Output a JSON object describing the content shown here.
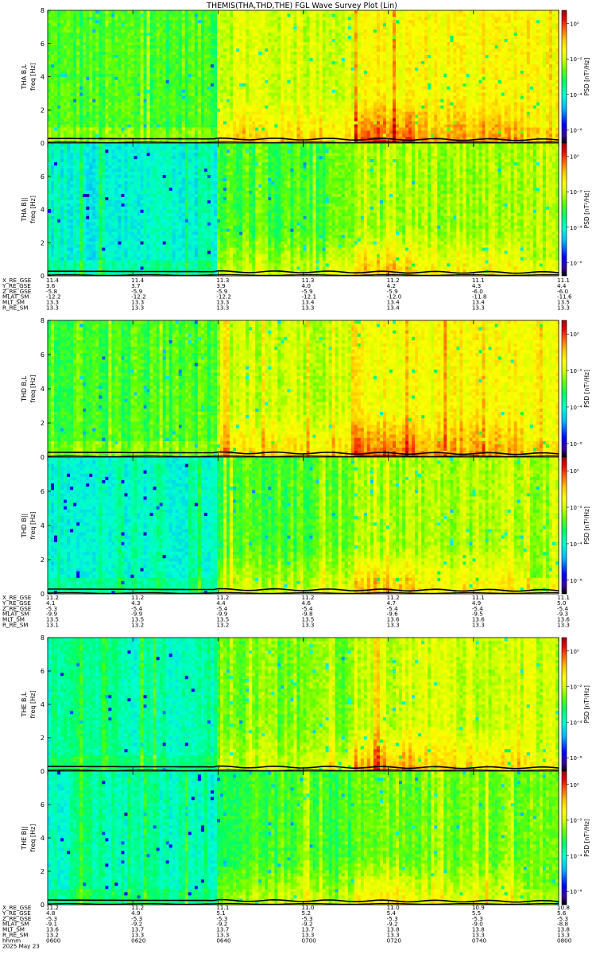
{
  "title": "THEMIS(THA,THD,THE) FGL Wave Survey Plot (Lin)",
  "colors": {
    "colormap": [
      "#000000",
      "#3a00a0",
      "#0000ff",
      "#00b4ff",
      "#00ffd2",
      "#00ff64",
      "#64ff00",
      "#d2ff00",
      "#ffff00",
      "#ffc800",
      "#ff6400",
      "#e60000",
      "#a00000"
    ],
    "trace": "#000000"
  },
  "chart_data": [
    {
      "type": "heatmap",
      "label": "THA B,L",
      "yunit": "freq [Hz]",
      "ytick_labels": [
        "0",
        "2",
        "4",
        "6",
        "8"
      ],
      "ylim": [
        0,
        8
      ],
      "cbar_label": "PSD [nT²/Hz]",
      "cbar_ticks": [
        "10⁰",
        "10⁻²",
        "10⁻⁴",
        "10⁻⁶"
      ],
      "cbar_ticks_data": [
        0,
        -2,
        -4,
        -6
      ]
    },
    {
      "type": "heatmap",
      "label": "THA B||",
      "yunit": "freq [Hz]",
      "ytick_labels": [
        "0",
        "2",
        "4",
        "6"
      ],
      "ylim": [
        0,
        8
      ],
      "cbar_label": "PSD [nT²/Hz]",
      "cbar_ticks": [
        "10⁰",
        "10⁻²",
        "10⁻⁴",
        "10⁻⁶"
      ],
      "cbar_ticks_data": [
        0,
        -2,
        -4,
        -6
      ]
    },
    {
      "type": "heatmap",
      "label": "THD B,L",
      "yunit": "freq [Hz]",
      "ytick_labels": [
        "0",
        "2",
        "4",
        "6",
        "8"
      ],
      "ylim": [
        0,
        8
      ],
      "cbar_label": "PSD [nT²/Hz]",
      "cbar_ticks": [
        "10⁰",
        "10⁻²",
        "10⁻⁴",
        "10⁻⁶"
      ],
      "cbar_ticks_data": [
        0,
        -2,
        -4,
        -6
      ]
    },
    {
      "type": "heatmap",
      "label": "THD B||",
      "yunit": "freq [Hz]",
      "ytick_labels": [
        "0",
        "2",
        "4",
        "6"
      ],
      "ylim": [
        0,
        8
      ],
      "cbar_label": "PSD [nT²/Hz]",
      "cbar_ticks": [
        "10⁰",
        "10⁻²",
        "10⁻⁴",
        "10⁻⁶"
      ],
      "cbar_ticks_data": [
        0,
        -2,
        -4,
        -6
      ]
    },
    {
      "type": "heatmap",
      "label": "THE B,L",
      "yunit": "freq [Hz]",
      "ytick_labels": [
        "0",
        "2",
        "4",
        "6",
        "8"
      ],
      "ylim": [
        0,
        8
      ],
      "cbar_label": "PSD [nT²/Hz]",
      "cbar_ticks": [
        "10⁰",
        "10⁻²",
        "10⁻⁴",
        "10⁻⁶"
      ],
      "cbar_ticks_data": [
        0,
        -2,
        -4,
        -6
      ]
    },
    {
      "type": "heatmap",
      "label": "THE B||",
      "yunit": "freq [Hz]",
      "ytick_labels": [
        "0",
        "2",
        "4",
        "6"
      ],
      "ylim": [
        0,
        8
      ],
      "cbar_label": "PSD [nT²/Hz]",
      "cbar_ticks": [
        "10⁰",
        "10⁻²",
        "10⁻⁴",
        "10⁻⁶"
      ],
      "cbar_ticks_data": [
        0,
        -2,
        -4,
        -6
      ]
    }
  ],
  "orbit_tables": [
    {
      "row_labels": [
        "X_RE_GSE",
        "Y_RE_GSE",
        "Z_RE_GSE",
        "MLAT_SM",
        "MLT_SM",
        "R_RE_SM"
      ],
      "columns": [
        [
          "11.4",
          "3.6",
          "-5.8",
          "-12.2",
          "13.3",
          "13.3"
        ],
        [
          "11.4",
          "3.7",
          "-5.9",
          "-12.2",
          "13.3",
          "13.3"
        ],
        [
          "11.3",
          "3.9",
          "-5.9",
          "-12.2",
          "13.3",
          "13.3"
        ],
        [
          "11.3",
          "4.0",
          "-5.9",
          "-12.1",
          "13.4",
          "13.3"
        ],
        [
          "11.2",
          "4.2",
          "-5.9",
          "-12.0",
          "13.4",
          "13.4"
        ],
        [
          "11.1",
          "4.3",
          "-6.0",
          "-11.8",
          "13.4",
          "13.3"
        ],
        [
          "11.1",
          "4.4",
          "-6.0",
          "-11.6",
          "13.5",
          "13.3"
        ]
      ]
    },
    {
      "row_labels": [
        "X_RE_GSE",
        "Y_RE_GSE",
        "Z_RE_GSE",
        "MLAT_SM",
        "MLT_SM",
        "R_RE_SM"
      ],
      "columns": [
        [
          "11.2",
          "4.1",
          "-5.3",
          "-9.9",
          "13.5",
          "13.1"
        ],
        [
          "11.2",
          "4.3",
          "-5.4",
          "-9.9",
          "13.5",
          "13.2"
        ],
        [
          "11.2",
          "4.4",
          "-5.4",
          "-9.9",
          "13.5",
          "13.2"
        ],
        [
          "11.2",
          "4.6",
          "-5.4",
          "-9.8",
          "13.5",
          "13.3"
        ],
        [
          "11.2",
          "4.7",
          "-5.4",
          "-9.6",
          "13.6",
          "13.3"
        ],
        [
          "11.1",
          "4.9",
          "-5.4",
          "-9.5",
          "13.6",
          "13.3"
        ],
        [
          "11.1",
          "5.0",
          "-5.4",
          "-9.3",
          "13.6",
          "13.3"
        ]
      ]
    },
    {
      "row_labels": [
        "X_RE_GSE",
        "Y_RE_GSE",
        "Z_RE_GSE",
        "MLAT_SM",
        "MLT_SM",
        "R_RE_SM",
        "hhmm"
      ],
      "columns": [
        [
          "11.2",
          "4.8",
          "-5.3",
          "-9.1",
          "13.6",
          "13.2",
          "0600"
        ],
        [
          "11.2",
          "4.9",
          "-5.3",
          "-9.2",
          "13.7",
          "13.3",
          "0620"
        ],
        [
          "11.1",
          "5.1",
          "-5.3",
          "-9.2",
          "13.7",
          "13.3",
          "0640"
        ],
        [
          "11.0",
          "5.2",
          "-5.3",
          "-9.2",
          "13.7",
          "13.3",
          "0700"
        ],
        [
          "11.0",
          "5.4",
          "-5.3",
          "-9.2",
          "13.8",
          "13.3",
          "0720"
        ],
        [
          "10.9",
          "5.5",
          "-5.3",
          "-9.0",
          "13.8",
          "13.3",
          "0740"
        ],
        [
          "10.8",
          "5.6",
          "-5.3",
          "-8.8",
          "13.8",
          "13.3",
          "0800"
        ]
      ]
    }
  ],
  "date_label": "2025 May 23"
}
